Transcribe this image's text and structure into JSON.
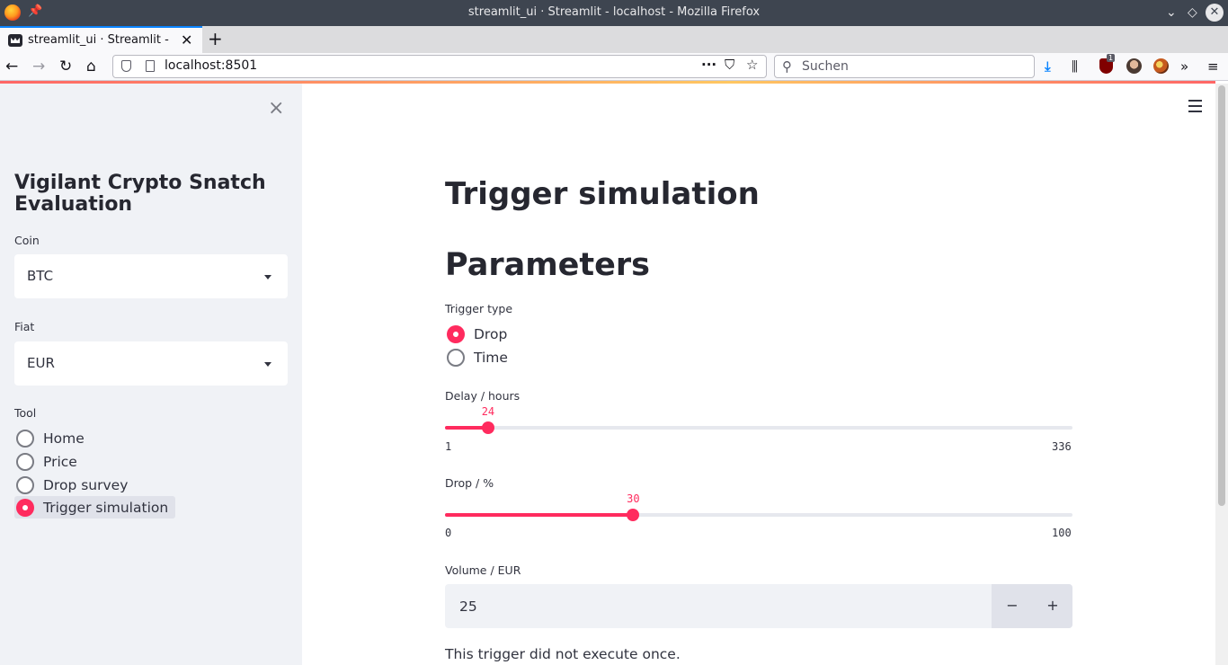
{
  "window": {
    "title": "streamlit_ui · Streamlit - localhost - Mozilla Firefox"
  },
  "tab": {
    "title": "streamlit_ui · Streamlit - localhost",
    "new_tab": "+"
  },
  "nav": {
    "url": "localhost:8501",
    "search_placeholder": "Suchen",
    "ublock_badge": "1"
  },
  "sidebar": {
    "title": "Vigilant Crypto Snatch Evaluation",
    "close": "×",
    "coin": {
      "label": "Coin",
      "value": "BTC"
    },
    "fiat": {
      "label": "Fiat",
      "value": "EUR"
    },
    "tool": {
      "label": "Tool",
      "options": [
        "Home",
        "Price",
        "Drop survey",
        "Trigger simulation"
      ],
      "selected": "Trigger simulation"
    }
  },
  "main": {
    "title": "Trigger simulation",
    "section": "Parameters",
    "trigger_type": {
      "label": "Trigger type",
      "options": [
        "Drop",
        "Time"
      ],
      "selected": "Drop"
    },
    "delay": {
      "label": "Delay / hours",
      "value": "24",
      "min": "1",
      "max": "336",
      "fraction": 0.0687
    },
    "drop": {
      "label": "Drop / %",
      "value": "30",
      "min": "0",
      "max": "100",
      "fraction": 0.3
    },
    "volume": {
      "label": "Volume / EUR",
      "value": "25",
      "minus": "−",
      "plus": "+"
    },
    "result_text": "This trigger did not execute once."
  },
  "colors": {
    "accent": "#ff2b5e",
    "sidebar_bg": "#f0f2f6",
    "text": "#31333f"
  }
}
